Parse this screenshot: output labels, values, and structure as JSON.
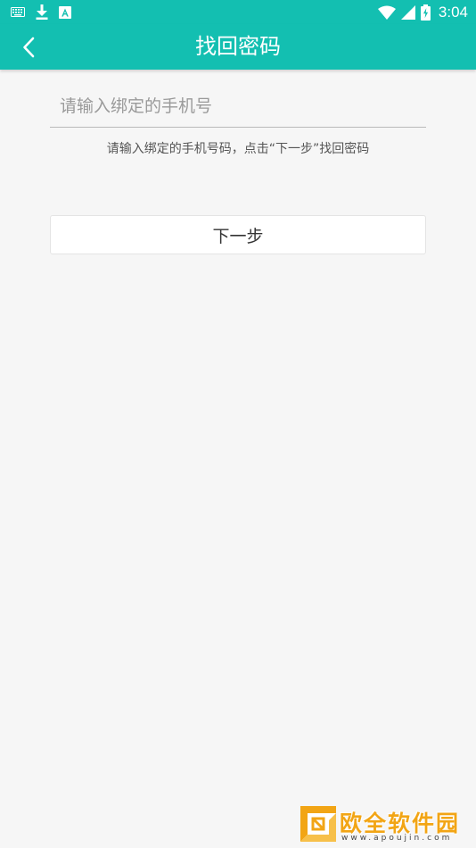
{
  "status_bar": {
    "time": "3:04",
    "left_icons": [
      "keyboard-icon",
      "download-icon",
      "a-notification-icon"
    ],
    "right_icons": [
      "wifi-icon",
      "signal-icon",
      "battery-icon"
    ]
  },
  "app_bar": {
    "title": "找回密码",
    "back_icon": "chevron-left-icon",
    "color": "#13bfb1"
  },
  "form": {
    "phone_placeholder": "请输入绑定的手机号",
    "phone_value": "",
    "hint": "请输入绑定的手机号码，点击“下一步”找回密码",
    "next_label": "下一步"
  },
  "watermark": {
    "name": "欧全软件园",
    "url": "www.apoujin.com",
    "color": "#f2a515"
  }
}
